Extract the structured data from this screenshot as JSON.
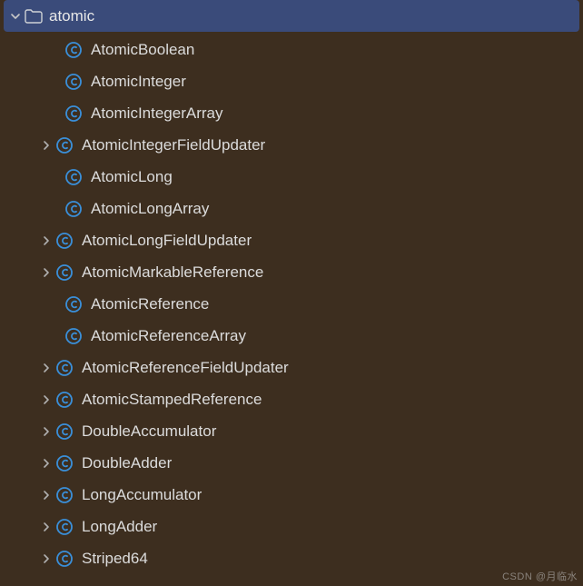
{
  "package": {
    "name": "atomic"
  },
  "classes": [
    {
      "name": "AtomicBoolean",
      "expandable": false
    },
    {
      "name": "AtomicInteger",
      "expandable": false
    },
    {
      "name": "AtomicIntegerArray",
      "expandable": false
    },
    {
      "name": "AtomicIntegerFieldUpdater",
      "expandable": true
    },
    {
      "name": "AtomicLong",
      "expandable": false
    },
    {
      "name": "AtomicLongArray",
      "expandable": false
    },
    {
      "name": "AtomicLongFieldUpdater",
      "expandable": true
    },
    {
      "name": "AtomicMarkableReference",
      "expandable": true
    },
    {
      "name": "AtomicReference",
      "expandable": false
    },
    {
      "name": "AtomicReferenceArray",
      "expandable": false
    },
    {
      "name": "AtomicReferenceFieldUpdater",
      "expandable": true
    },
    {
      "name": "AtomicStampedReference",
      "expandable": true
    },
    {
      "name": "DoubleAccumulator",
      "expandable": true
    },
    {
      "name": "DoubleAdder",
      "expandable": true
    },
    {
      "name": "LongAccumulator",
      "expandable": true
    },
    {
      "name": "LongAdder",
      "expandable": true
    },
    {
      "name": "Striped64",
      "expandable": true
    }
  ],
  "watermark": "CSDN @月临水"
}
